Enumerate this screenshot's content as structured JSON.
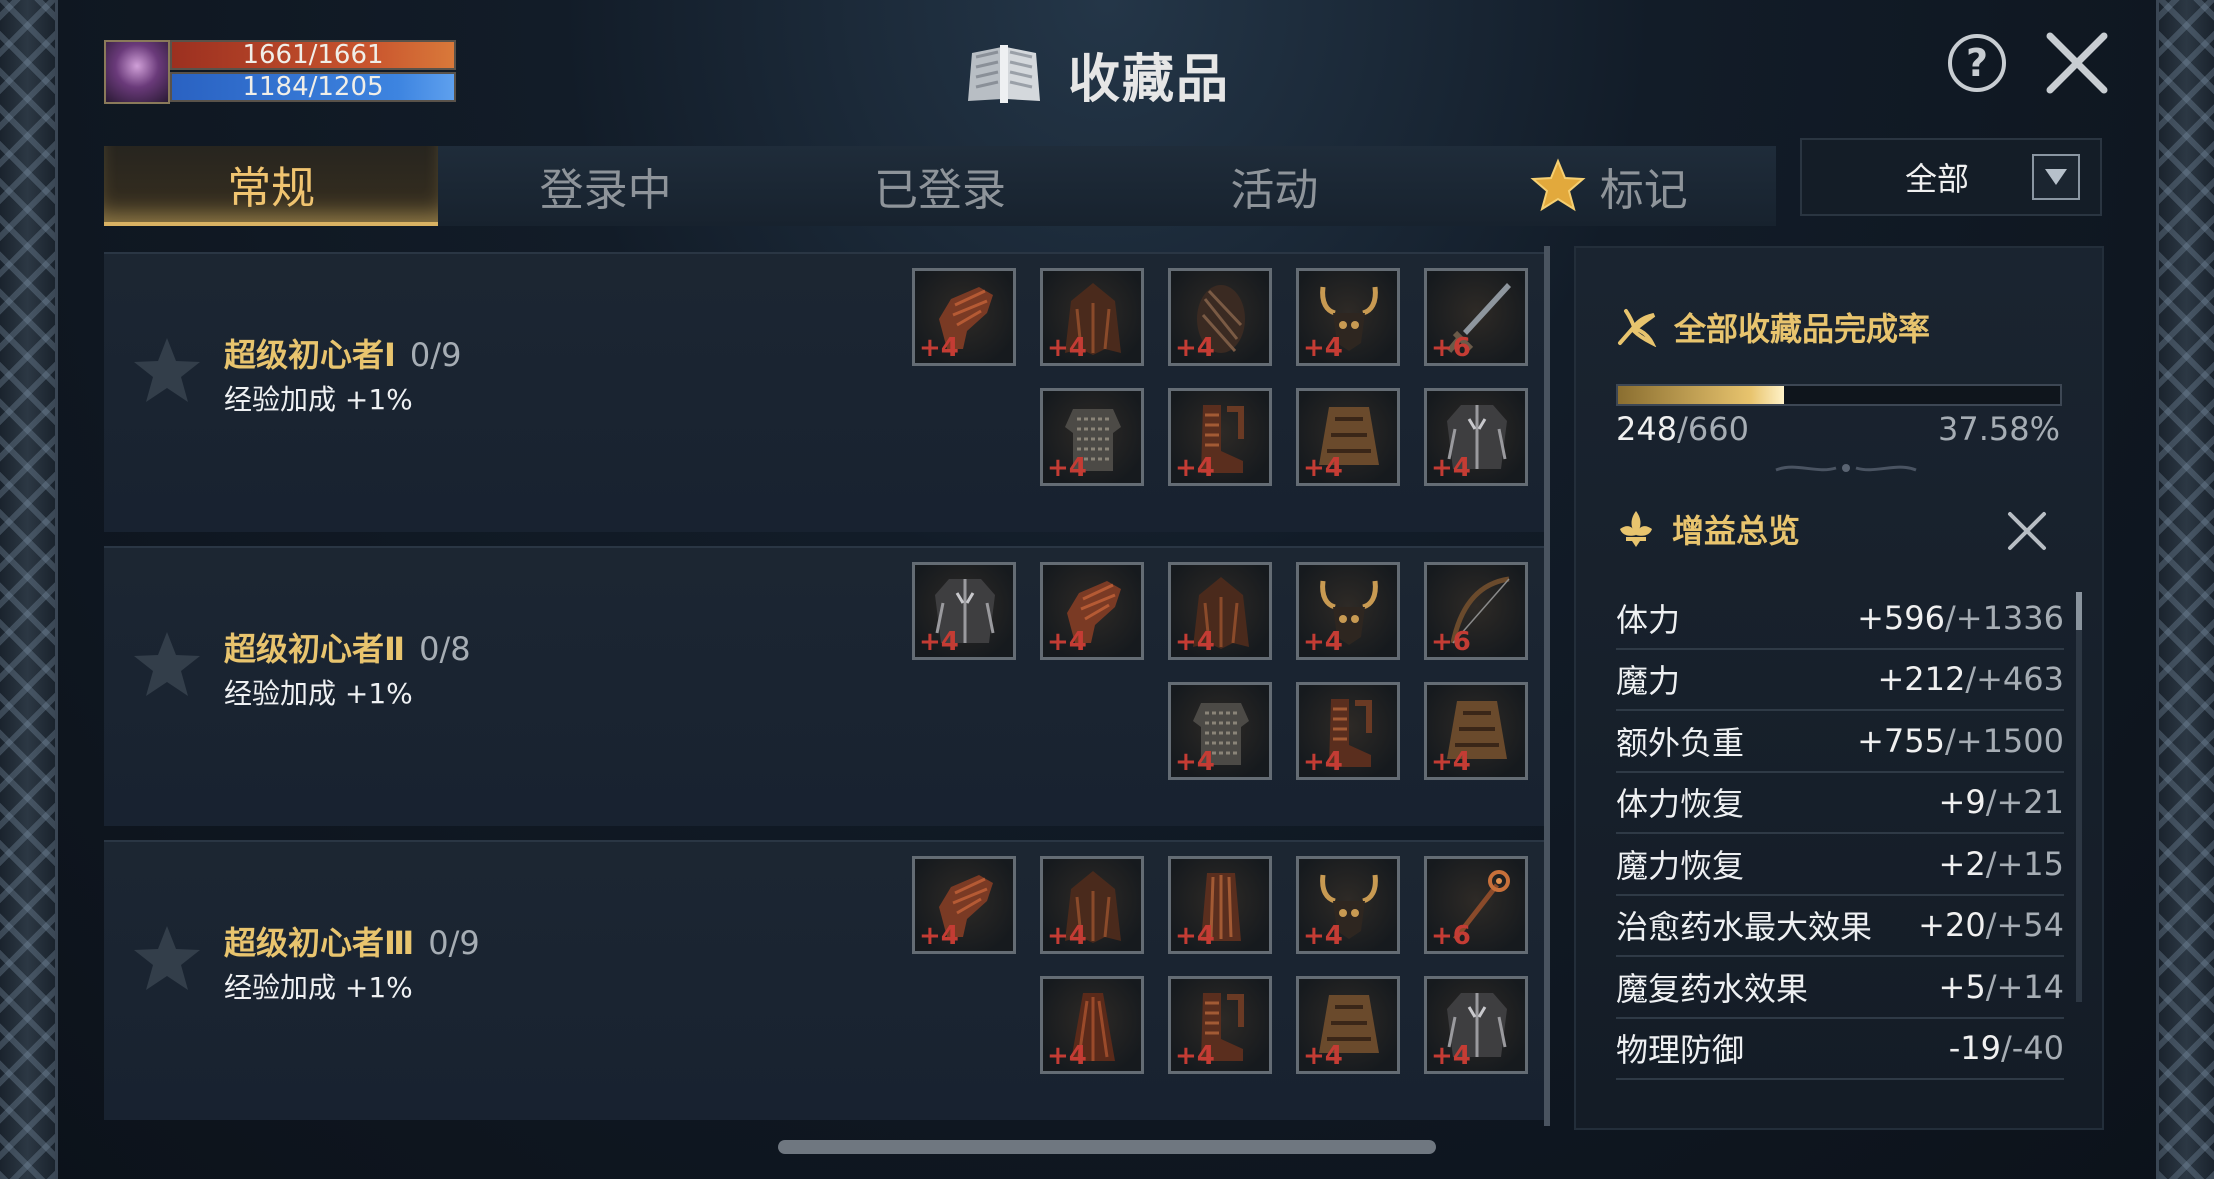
{
  "player": {
    "hp": "1661/1661",
    "mp": "1184/1205",
    "hp_fraction": 1.0,
    "mp_fraction": 0.982
  },
  "header": {
    "title": "收藏品"
  },
  "tabs": [
    {
      "label": "常规",
      "active": true
    },
    {
      "label": "登录中",
      "active": false
    },
    {
      "label": "已登录",
      "active": false
    },
    {
      "label": "活动",
      "active": false
    },
    {
      "label": "标记",
      "active": false,
      "icon": "star-icon"
    }
  ],
  "filter": {
    "selected": "全部"
  },
  "sets": [
    {
      "name": "超级初心者Ⅰ",
      "progress": "0/9",
      "bonus": "经验加成 +1%",
      "items": [
        {
          "icon": "gloves-icon",
          "enhance": "+4"
        },
        {
          "icon": "cloak-icon",
          "enhance": "+4"
        },
        {
          "icon": "helmet-icon",
          "enhance": "+4"
        },
        {
          "icon": "horned-helm-icon",
          "enhance": "+4"
        },
        {
          "icon": "sword-icon",
          "enhance": "+6"
        },
        {
          "icon": "chainmail-icon",
          "enhance": "+4"
        },
        {
          "icon": "boots-icon",
          "enhance": "+4"
        },
        {
          "icon": "skirt-icon",
          "enhance": "+4"
        },
        {
          "icon": "jacket-icon",
          "enhance": "+4"
        }
      ]
    },
    {
      "name": "超级初心者Ⅱ",
      "progress": "0/8",
      "bonus": "经验加成 +1%",
      "items": [
        {
          "icon": "jacket-icon",
          "enhance": "+4"
        },
        {
          "icon": "gloves-icon",
          "enhance": "+4"
        },
        {
          "icon": "cloak-icon",
          "enhance": "+4"
        },
        {
          "icon": "horned-helm-icon",
          "enhance": "+4"
        },
        {
          "icon": "bow-icon",
          "enhance": "+6"
        },
        {
          "icon": "chainmail-icon",
          "enhance": "+4"
        },
        {
          "icon": "boots-icon",
          "enhance": "+4"
        },
        {
          "icon": "skirt-icon",
          "enhance": "+4"
        }
      ]
    },
    {
      "name": "超级初心者Ⅲ",
      "progress": "0/9",
      "bonus": "经验加成 +1%",
      "items": [
        {
          "icon": "gloves-icon",
          "enhance": "+4"
        },
        {
          "icon": "cloak-icon",
          "enhance": "+4"
        },
        {
          "icon": "bracer-icon",
          "enhance": "+4"
        },
        {
          "icon": "horned-helm-icon",
          "enhance": "+4"
        },
        {
          "icon": "staff-icon",
          "enhance": "+6"
        },
        {
          "icon": "robe-icon",
          "enhance": "+4"
        },
        {
          "icon": "boots-icon",
          "enhance": "+4"
        },
        {
          "icon": "skirt-icon",
          "enhance": "+4"
        },
        {
          "icon": "jacket-icon",
          "enhance": "+4"
        }
      ]
    }
  ],
  "completion": {
    "title": "全部收藏品完成率",
    "count": "248",
    "total": "/660",
    "percent": "37.58%",
    "fraction": 0.3758
  },
  "buffs": {
    "title": "增益总览",
    "stats": [
      {
        "name": "体力",
        "value": "+596",
        "max": "/+1336"
      },
      {
        "name": "魔力",
        "value": "+212",
        "max": "/+463"
      },
      {
        "name": "额外负重",
        "value": "+755",
        "max": "/+1500"
      },
      {
        "name": "体力恢复",
        "value": "+9",
        "max": "/+21"
      },
      {
        "name": "魔力恢复",
        "value": "+2",
        "max": "/+15"
      },
      {
        "name": "治愈药水最大效果",
        "value": "+20",
        "max": "/+54"
      },
      {
        "name": "魔复药水效果",
        "value": "+5",
        "max": "/+14"
      },
      {
        "name": "物理防御",
        "value": "-19",
        "max": "/-40"
      }
    ]
  },
  "colors": {
    "accent_gold": "#e8c46e",
    "enhance_red": "#c43c34",
    "hp": "#c9552e",
    "mp": "#3d84e0"
  }
}
